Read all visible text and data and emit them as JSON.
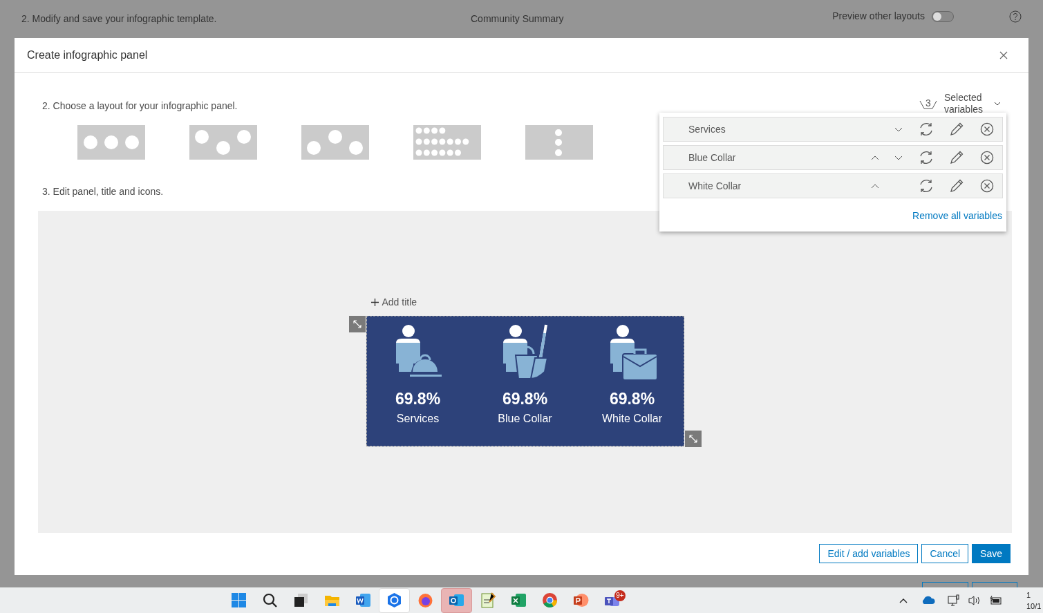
{
  "background_page": {
    "step": "2.  Modify and save your infographic template.",
    "title": "Community Summary",
    "preview_toggle": {
      "label": "Preview other layouts",
      "on": false
    }
  },
  "dialog": {
    "title": "Create infographic panel",
    "layout_step": "2.  Choose a layout for your infographic panel.",
    "layouts": [
      {
        "kind": "row3",
        "selected": false
      },
      {
        "kind": "zigzag_down",
        "selected": false
      },
      {
        "kind": "zigzag_up",
        "selected": false
      },
      {
        "kind": "grid",
        "selected": false
      },
      {
        "kind": "column3",
        "selected": false
      }
    ],
    "edit_step": "3.  Edit panel, title and icons.",
    "selected_variables": {
      "count": "3",
      "label": "Selected variables",
      "expanded": true,
      "variables": [
        {
          "name": "Services",
          "can_move_up": false,
          "can_move_down": true
        },
        {
          "name": "Blue Collar",
          "can_move_up": true,
          "can_move_down": true
        },
        {
          "name": "White Collar",
          "can_move_up": true,
          "can_move_down": false
        }
      ],
      "remove_all": "Remove all variables"
    },
    "add_title": "Add title",
    "panel_items": [
      {
        "kind": "services",
        "value": "69.8%",
        "label": "Services"
      },
      {
        "kind": "blue_collar",
        "value": "69.8%",
        "label": "Blue Collar"
      },
      {
        "kind": "white_collar",
        "value": "69.8%",
        "label": "White Collar"
      }
    ],
    "buttons": [
      {
        "label": "Edit / add variables",
        "kind": "outline"
      },
      {
        "label": "Cancel",
        "kind": "outline"
      },
      {
        "label": "Save",
        "kind": "primary"
      }
    ]
  },
  "taskbar": {
    "apps": [
      {
        "kind": "start",
        "active": false
      },
      {
        "kind": "search",
        "active": false
      },
      {
        "kind": "taskview",
        "active": false
      },
      {
        "kind": "folder",
        "active": false
      },
      {
        "kind": "word",
        "active": false
      },
      {
        "kind": "shield",
        "active": true
      },
      {
        "kind": "firefox",
        "active": false
      },
      {
        "kind": "outlook",
        "active": true
      },
      {
        "kind": "notepad",
        "active": false
      },
      {
        "kind": "excel",
        "active": false
      },
      {
        "kind": "chrome",
        "active": false
      },
      {
        "kind": "powerpoint",
        "active": false
      },
      {
        "kind": "teams",
        "active": false,
        "badge": "9+"
      }
    ],
    "clock_time": "1",
    "clock_date": "10/1"
  }
}
